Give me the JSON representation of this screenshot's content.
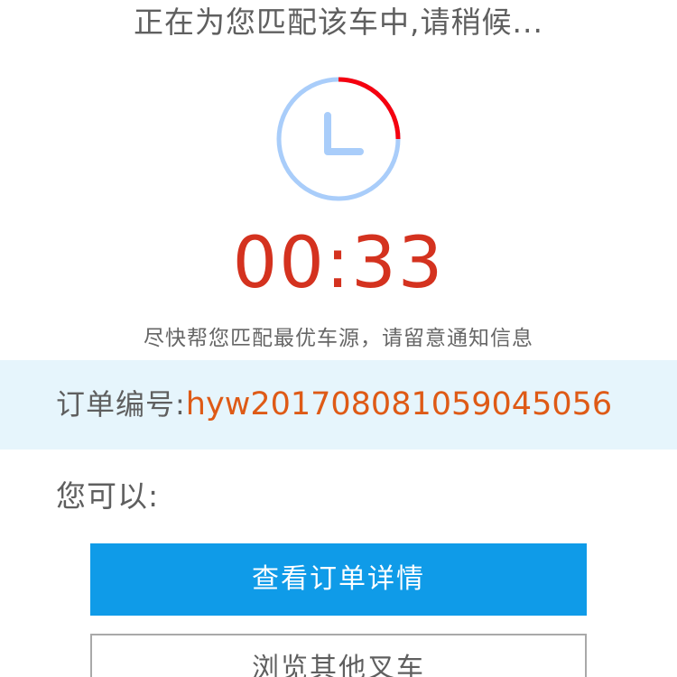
{
  "status": {
    "title": "正在为您匹配该车中,请稍候..."
  },
  "timer": {
    "countdown": "00:33",
    "progress_fraction": 0.25,
    "ring_color": "#a9cdfa",
    "progress_color": "#f5000f"
  },
  "hint": {
    "text": "尽快帮您匹配最优车源，请留意通知信息"
  },
  "order": {
    "label": "订单编号:",
    "number": "hyw2017080810590450 56"
  },
  "options": {
    "label": "您可以:"
  },
  "actions": {
    "primary_label": "查看订单详情",
    "secondary_label": "浏览其他叉车"
  },
  "colors": {
    "countdown": "#d4321f",
    "order_number": "#de5a16",
    "band_background": "#e6f5fc",
    "primary_button": "#0f9be8"
  }
}
